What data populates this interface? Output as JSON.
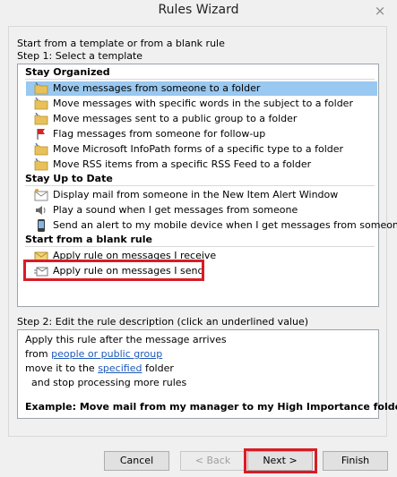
{
  "window": {
    "title": "Rules Wizard",
    "close_label": "×"
  },
  "intro": "Start from a template or from a blank rule",
  "step1": "Step 1: Select a template",
  "groups": [
    {
      "title": "Stay Organized",
      "items": [
        {
          "label": "Move messages from someone to a folder",
          "icon": "folder-icon",
          "selected": true
        },
        {
          "label": "Move messages with specific words in the subject to a folder",
          "icon": "folder-icon"
        },
        {
          "label": "Move messages sent to a public group to a folder",
          "icon": "folder-icon"
        },
        {
          "label": "Flag messages from someone for follow-up",
          "icon": "flag-icon"
        },
        {
          "label": "Move Microsoft InfoPath forms of a specific type to a folder",
          "icon": "folder-icon"
        },
        {
          "label": "Move RSS items from a specific RSS Feed to a folder",
          "icon": "folder-icon"
        }
      ]
    },
    {
      "title": "Stay Up to Date",
      "items": [
        {
          "label": "Display mail from someone in the New Item Alert Window",
          "icon": "envelope-alert-icon"
        },
        {
          "label": "Play a sound when I get messages from someone",
          "icon": "speaker-icon"
        },
        {
          "label": "Send an alert to my mobile device when I get messages from someone",
          "icon": "mobile-phone-icon"
        }
      ]
    },
    {
      "title": "Start from a blank rule",
      "items": [
        {
          "label": "Apply rule on messages I receive",
          "icon": "envelope-icon"
        },
        {
          "label": "Apply rule on messages I send",
          "icon": "send-mail-icon"
        }
      ]
    }
  ],
  "step2": "Step 2: Edit the rule description (click an underlined value)",
  "description": {
    "line1": "Apply this rule after the message arrives",
    "line2_prefix": "from ",
    "line2_link": "people or public group",
    "line3_prefix": "move it to the ",
    "line3_link": "specified",
    "line3_suffix": " folder",
    "line4": "  and stop processing more rules",
    "example": "Example: Move mail from my manager to my High Importance folder"
  },
  "buttons": {
    "cancel": "Cancel",
    "back": "< Back",
    "next": "Next >",
    "finish": "Finish"
  },
  "colors": {
    "selection": "#99c8f0",
    "highlight": "#d91c25",
    "link": "#1d59b8"
  }
}
